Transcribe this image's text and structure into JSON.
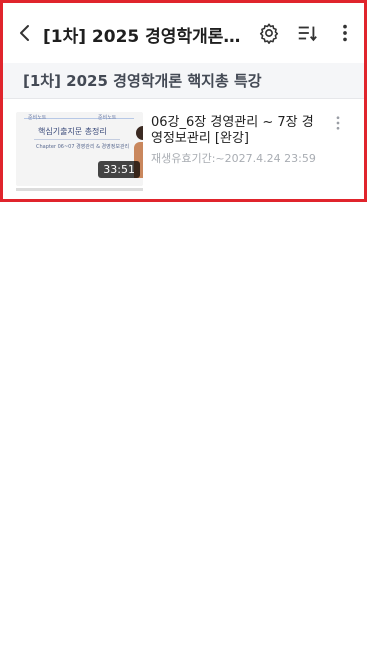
{
  "appbar": {
    "title": "[1차] 2025 경영학개론 핵지총 특강",
    "back_icon": "chevron-left-icon",
    "settings_icon": "gear-icon",
    "sort_icon": "sort-list-icon",
    "more_icon": "more-vertical-icon"
  },
  "section": {
    "title": "[1차] 2025 경영학개론 핵지총 특강"
  },
  "lectures": [
    {
      "title": "06강_6장 경영관리 ~ 7장 경영정보관리 [완강]",
      "period": "재생유효기간:~2027.4.24 23:59",
      "duration": "33:51",
      "progress": 0,
      "thumbnail": {
        "tag_left": "준비노트",
        "tag_right": "준비노트",
        "heading": "핵심기출지문 총정리",
        "sub": "Chapter 06~07 경영관리 & 경영정보관리"
      }
    }
  ],
  "colors": {
    "highlight_border": "#e0242c",
    "section_bg": "#f5f6f8"
  }
}
